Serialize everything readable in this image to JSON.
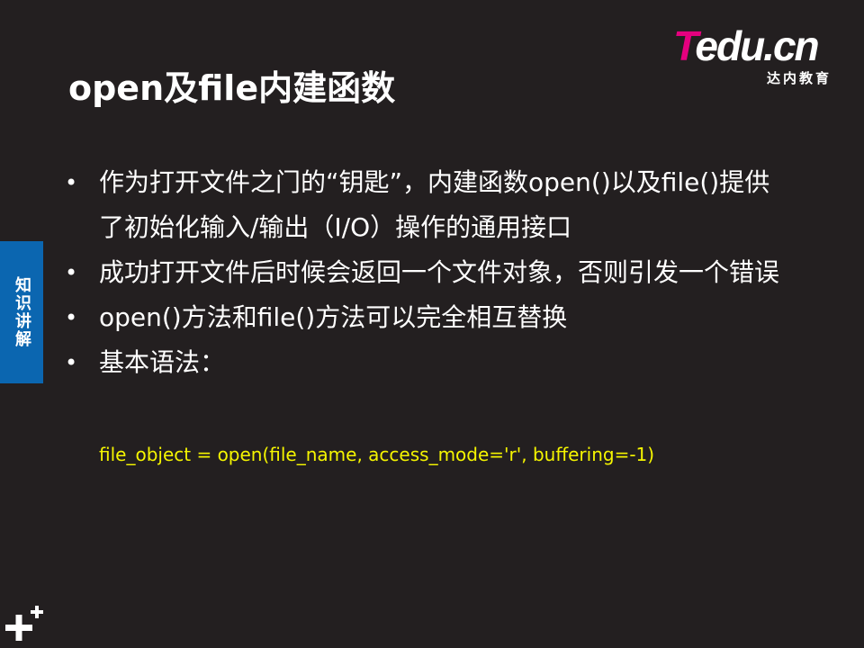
{
  "logo": {
    "main_t": "T",
    "main_rest": "edu.cn",
    "sub": "达内教育"
  },
  "title": "open及file内建函数",
  "side_tab": "知识讲解",
  "bullets": [
    "作为打开文件之门的“钥匙”，内建函数open()以及file()提供了初始化输入/输出（I/O）操作的通用接口",
    "成功打开文件后时候会返回一个文件对象，否则引发一个错误",
    "open()方法和file()方法可以完全相互替换",
    "基本语法："
  ],
  "code": "file_object = open(file_name, access_mode='r', buffering=-1)",
  "colors": {
    "background": "#231f20",
    "logo_accent": "#e5007f",
    "side_tab": "#0b66b0",
    "code": "#f5f500"
  },
  "icons": [
    "plus-icon"
  ]
}
